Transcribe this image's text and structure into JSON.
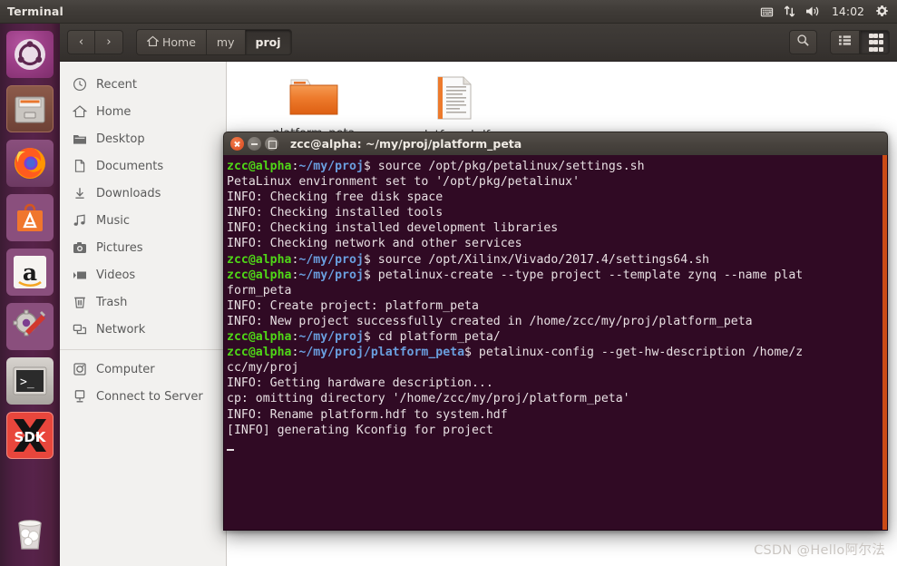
{
  "panel": {
    "title": "Terminal",
    "clock": "14:02",
    "tray_icons": [
      "keyboard-icon",
      "network-icon",
      "volume-icon",
      "system-menu-icon"
    ]
  },
  "launcher": {
    "items": [
      {
        "name": "ubuntu-dash",
        "label": "Dash home",
        "running": false
      },
      {
        "name": "files",
        "label": "Files",
        "running": true
      },
      {
        "name": "firefox",
        "label": "Firefox Web Browser",
        "running": false
      },
      {
        "name": "software-center",
        "label": "Ubuntu Software",
        "running": false
      },
      {
        "name": "amazon",
        "label": "Amazon",
        "running": false
      },
      {
        "name": "system-settings",
        "label": "System Settings",
        "running": false
      },
      {
        "name": "terminal",
        "label": "Terminal",
        "running": true
      },
      {
        "name": "sdk",
        "label": "SDK",
        "running": true
      },
      {
        "name": "trash",
        "label": "Trash",
        "running": false
      }
    ]
  },
  "file_manager": {
    "nav": {
      "back": "‹",
      "forward": "›"
    },
    "breadcrumbs": [
      {
        "label": "Home",
        "icon": "home-icon",
        "active": false
      },
      {
        "label": "my",
        "icon": "",
        "active": false
      },
      {
        "label": "proj",
        "icon": "",
        "active": true
      }
    ],
    "toolbar_right": [
      "search-icon",
      "list-view-icon",
      "grid-view-icon"
    ],
    "sidebar": {
      "items": [
        {
          "label": "Recent",
          "icon": "clock-icon"
        },
        {
          "label": "Home",
          "icon": "home-icon"
        },
        {
          "label": "Desktop",
          "icon": "folder-icon"
        },
        {
          "label": "Documents",
          "icon": "document-icon"
        },
        {
          "label": "Downloads",
          "icon": "download-icon"
        },
        {
          "label": "Music",
          "icon": "music-icon"
        },
        {
          "label": "Pictures",
          "icon": "camera-icon"
        },
        {
          "label": "Videos",
          "icon": "video-icon"
        },
        {
          "label": "Trash",
          "icon": "trash-icon"
        }
      ],
      "items_bottom": [
        {
          "label": "Computer",
          "icon": "computer-icon"
        },
        {
          "label": "Connect to Server",
          "icon": "server-icon"
        }
      ]
    },
    "files": [
      {
        "label": "platform_peta",
        "type": "folder"
      },
      {
        "label": "platform.hdf",
        "type": "document"
      }
    ]
  },
  "terminal": {
    "title": "zcc@alpha: ~/my/proj/platform_peta",
    "window_buttons": [
      "close-icon",
      "minimize-icon",
      "maximize-icon"
    ],
    "prompt_user": "zcc@alpha",
    "colors": {
      "background": "#300a24",
      "user": "#4fd717",
      "path": "#6a9fdf",
      "text": "#e8e0e3",
      "scrollbar": "#cb4b16"
    },
    "lines": [
      {
        "type": "prompt",
        "user": "zcc@alpha",
        "path": "~/my/proj",
        "cmd": "$ source /opt/pkg/petalinux/settings.sh"
      },
      {
        "type": "out",
        "text": "PetaLinux environment set to '/opt/pkg/petalinux'"
      },
      {
        "type": "out",
        "text": "INFO: Checking free disk space"
      },
      {
        "type": "out",
        "text": "INFO: Checking installed tools"
      },
      {
        "type": "out",
        "text": "INFO: Checking installed development libraries"
      },
      {
        "type": "out",
        "text": "INFO: Checking network and other services"
      },
      {
        "type": "prompt",
        "user": "zcc@alpha",
        "path": "~/my/proj",
        "cmd": "$ source /opt/Xilinx/Vivado/2017.4/settings64.sh"
      },
      {
        "type": "prompt",
        "user": "zcc@alpha",
        "path": "~/my/proj",
        "cmd": "$ petalinux-create --type project --template zynq --name plat"
      },
      {
        "type": "out",
        "text": "form_peta"
      },
      {
        "type": "out",
        "text": "INFO: Create project: platform_peta"
      },
      {
        "type": "out",
        "text": "INFO: New project successfully created in /home/zcc/my/proj/platform_peta"
      },
      {
        "type": "prompt",
        "user": "zcc@alpha",
        "path": "~/my/proj",
        "cmd": "$ cd platform_peta/"
      },
      {
        "type": "prompt",
        "user": "zcc@alpha",
        "path": "~/my/proj/platform_peta",
        "cmd": "$ petalinux-config --get-hw-description /home/z"
      },
      {
        "type": "out",
        "text": "cc/my/proj"
      },
      {
        "type": "out",
        "text": "INFO: Getting hardware description..."
      },
      {
        "type": "out",
        "text": "cp: omitting directory '/home/zcc/my/proj/platform_peta'"
      },
      {
        "type": "out",
        "text": "INFO: Rename platform.hdf to system.hdf"
      },
      {
        "type": "out",
        "text": "[INFO] generating Kconfig for project"
      }
    ]
  },
  "watermark": {
    "text": "CSDN @Hello阿尔法"
  }
}
